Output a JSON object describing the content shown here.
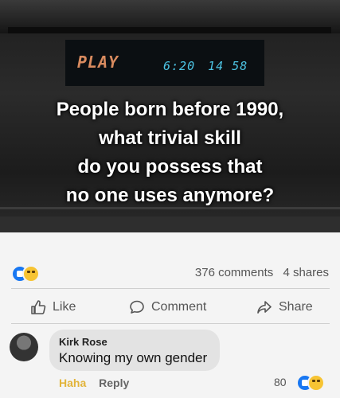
{
  "media": {
    "vcr_display_mode": "PLAY",
    "vcr_display_time": "6:20",
    "vcr_display_counter": "14 58",
    "caption_lines": [
      "People born before 1990,",
      "what trivial skill",
      "do you possess that",
      "no one uses anymore?"
    ]
  },
  "stats": {
    "comments": "376 comments",
    "shares": "4 shares"
  },
  "actions": {
    "like": "Like",
    "comment": "Comment",
    "share": "Share"
  },
  "comment": {
    "author": "Kirk Rose",
    "text": "Knowing my own gender",
    "haha_label": "Haha",
    "reply_label": "Reply",
    "reaction_count": "80"
  },
  "colors": {
    "like_blue": "#1877f2",
    "haha_yellow": "#f7c433",
    "lcd_orange": "#d98b5f",
    "lcd_cyan": "#4cc3e3"
  },
  "icons": [
    "like-reaction-icon",
    "haha-reaction-icon",
    "thumbs-up-icon",
    "comment-icon",
    "share-icon"
  ]
}
